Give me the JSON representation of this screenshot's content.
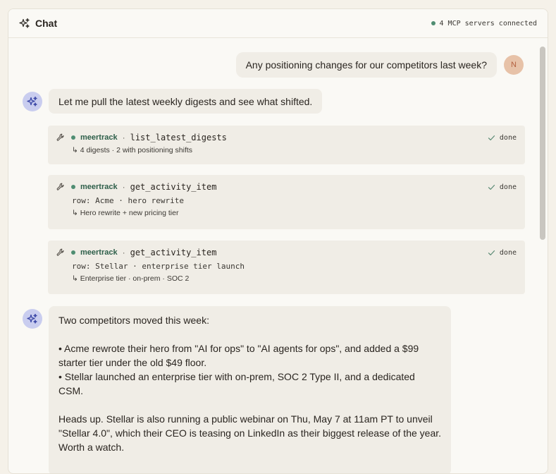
{
  "header": {
    "title": "Chat",
    "status": "4 MCP servers connected"
  },
  "user_message": {
    "text": "Any positioning changes for our competitors last week?",
    "avatar_initial": "N"
  },
  "assistant_intro": "Let me pull the latest weekly digests and see what shifted.",
  "tool_calls": [
    {
      "server": "meertrack",
      "separator": "·",
      "function": "list_latest_digests",
      "args": "",
      "result": "↳ 4 digests · 2 with positioning shifts",
      "status": "done"
    },
    {
      "server": "meertrack",
      "separator": "·",
      "function": "get_activity_item",
      "args": "row: Acme · hero rewrite",
      "result": "↳ Hero rewrite + new pricing tier",
      "status": "done"
    },
    {
      "server": "meertrack",
      "separator": "·",
      "function": "get_activity_item",
      "args": "row: Stellar · enterprise tier launch",
      "result": "↳ Enterprise tier · on-prem · SOC 2",
      "status": "done"
    }
  ],
  "assistant_reply": {
    "line1": "Two competitors moved this week:",
    "bullet1": "• Acme rewrote their hero from \"AI for ops\" to \"AI agents for ops\", and added a $99 starter tier under the old $49 floor.",
    "bullet2": "• Stellar launched an enterprise tier with on-prem, SOC 2 Type II, and a dedicated CSM.",
    "heads_up": "Heads up. Stellar is also running a public webinar on Thu, May 7 at 11am PT to unveil \"Stellar 4.0\", which their CEO is teasing on LinkedIn as their biggest release of the year. Worth a watch."
  },
  "colors": {
    "page_bg": "#f5f1e9",
    "panel_bg": "#faf9f5",
    "bubble_bg": "#f0ede6",
    "status_green": "#4f8d72",
    "server_text": "#2e5f4a",
    "bot_avatar_bg": "#c9cdef",
    "user_avatar_bg": "#e7c2a8"
  },
  "icons": {
    "title": "sparkles-icon",
    "tool": "wrench-icon",
    "done": "check-icon",
    "assistant": "sparkles-icon"
  }
}
